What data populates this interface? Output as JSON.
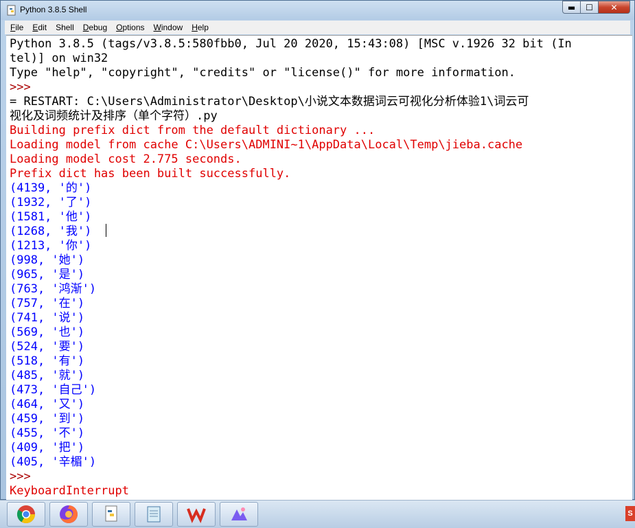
{
  "window": {
    "title": "Python 3.8.5 Shell",
    "controls": {
      "minimize": "▬",
      "maximize": "☐",
      "close": "✕"
    }
  },
  "menu": [
    {
      "u": "F",
      "rest": "ile"
    },
    {
      "u": "E",
      "rest": "dit"
    },
    {
      "u": "She",
      "rest": "ll",
      "pre": "She",
      "uo": "l"
    },
    {
      "u": "D",
      "rest": "ebug"
    },
    {
      "u": "O",
      "rest": "ptions"
    },
    {
      "u": "W",
      "rest": "indow"
    },
    {
      "u": "H",
      "rest": "elp"
    }
  ],
  "menu_labels": [
    "File",
    "Edit",
    "Shell",
    "Debug",
    "Options",
    "Window",
    "Help"
  ],
  "shell_lines": [
    {
      "text": "Python 3.8.5 (tags/v3.8.5:580fbb0, Jul 20 2020, 15:43:08) [MSC v.1926 32 bit (In",
      "color": "blk"
    },
    {
      "text": "tel)] on win32",
      "color": "blk"
    },
    {
      "text": "Type \"help\", \"copyright\", \"credits\" or \"license()\" for more information.",
      "color": "blk"
    },
    {
      "text": ">>> ",
      "color": "prompt"
    },
    {
      "text": "= RESTART: C:\\Users\\Administrator\\Desktop\\小说文本数据词云可视化分析体验1\\词云可",
      "color": "blk"
    },
    {
      "text": "视化及词频统计及排序（单个字符）.py",
      "color": "blk"
    },
    {
      "text": "Building prefix dict from the default dictionary ...",
      "color": "red"
    },
    {
      "text": "Loading model from cache C:\\Users\\ADMINI~1\\AppData\\Local\\Temp\\jieba.cache",
      "color": "red"
    },
    {
      "text": "Loading model cost 2.775 seconds.",
      "color": "red"
    },
    {
      "text": "Prefix dict has been built successfully.",
      "color": "red"
    },
    {
      "text": "(4139, '的')",
      "color": "blu"
    },
    {
      "text": "(1932, '了')",
      "color": "blu"
    },
    {
      "text": "(1581, '他')",
      "color": "blu"
    },
    {
      "text": "(1268, '我')",
      "color": "blu"
    },
    {
      "text": "(1213, '你')",
      "color": "blu"
    },
    {
      "text": "(998, '她')",
      "color": "blu"
    },
    {
      "text": "(965, '是')",
      "color": "blu"
    },
    {
      "text": "(763, '鸿渐')",
      "color": "blu"
    },
    {
      "text": "(757, '在')",
      "color": "blu"
    },
    {
      "text": "(741, '说')",
      "color": "blu"
    },
    {
      "text": "(569, '也')",
      "color": "blu"
    },
    {
      "text": "(524, '要')",
      "color": "blu"
    },
    {
      "text": "(518, '有')",
      "color": "blu"
    },
    {
      "text": "(485, '就')",
      "color": "blu"
    },
    {
      "text": "(473, '自己')",
      "color": "blu"
    },
    {
      "text": "(464, '又')",
      "color": "blu"
    },
    {
      "text": "(459, '到')",
      "color": "blu"
    },
    {
      "text": "(455, '不')",
      "color": "blu"
    },
    {
      "text": "(409, '把')",
      "color": "blu"
    },
    {
      "text": "(405, '辛楣')",
      "color": "blu"
    },
    {
      "text": ">>> ",
      "color": "prompt"
    },
    {
      "text": "KeyboardInterrupt",
      "color": "red"
    }
  ],
  "taskbar": [
    {
      "icon": "chrome-icon"
    },
    {
      "icon": "firefox-icon"
    },
    {
      "icon": "python-idle-icon"
    },
    {
      "icon": "notepad-icon"
    },
    {
      "icon": "wps-writer-icon"
    },
    {
      "icon": "image-viewer-icon"
    }
  ],
  "tray_logo": "S"
}
